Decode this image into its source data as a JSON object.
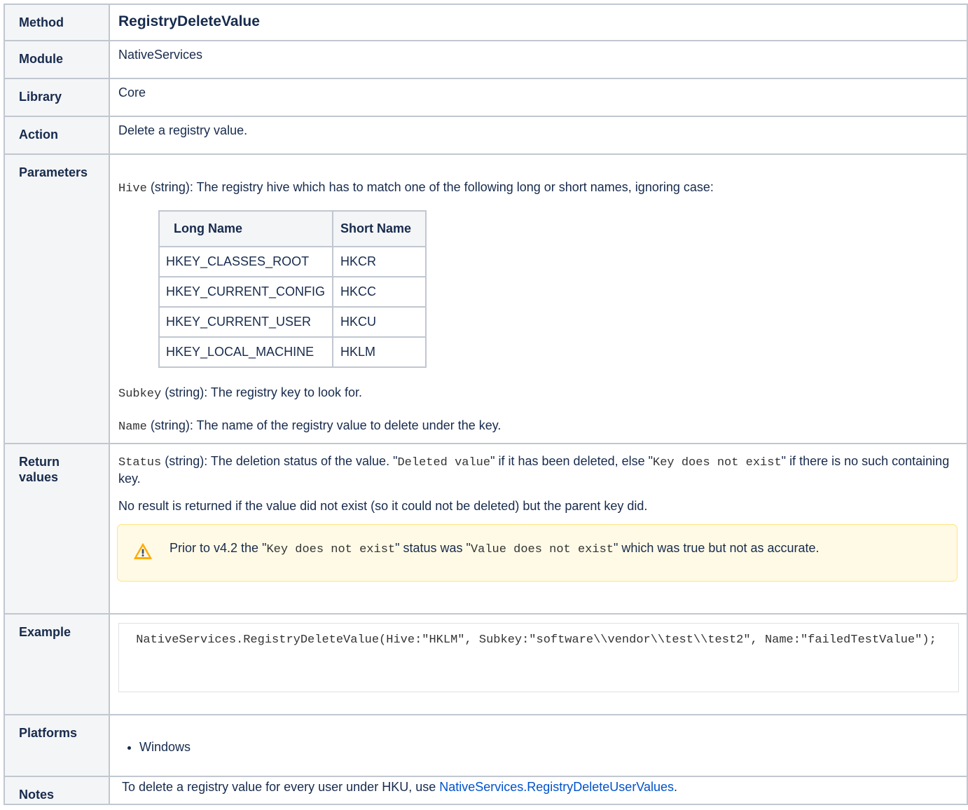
{
  "rows": {
    "method": {
      "label": "Method",
      "value": "RegistryDeleteValue"
    },
    "module": {
      "label": "Module",
      "value": "NativeServices"
    },
    "library": {
      "label": "Library",
      "value": "Core"
    },
    "action": {
      "label": "Action",
      "value": "Delete a registry value."
    },
    "parameters": {
      "label": "Parameters",
      "hive_code": "Hive",
      "hive_text": " (string): The registry hive which has to match one of the following long or short names, ignoring case:",
      "hive_table": {
        "headers": [
          "Long Name",
          "Short Name"
        ],
        "rows": [
          [
            "HKEY_CLASSES_ROOT",
            "HKCR"
          ],
          [
            "HKEY_CURRENT_CONFIG",
            "HKCC"
          ],
          [
            "HKEY_CURRENT_USER",
            "HKCU"
          ],
          [
            "HKEY_LOCAL_MACHINE",
            "HKLM"
          ]
        ]
      },
      "subkey_code": "Subkey",
      "subkey_text": " (string): The registry key to look for.",
      "name_code": "Name",
      "name_text": " (string): The name of the registry value to delete under the key."
    },
    "return_values": {
      "label_line1": "Return",
      "label_line2": "values",
      "status_code": "Status",
      "status_text1": " (string): The deletion status of the value. \"",
      "deleted_code": "Deleted value",
      "status_text2": "\" if it has been deleted, else \"",
      "keynot_code": "Key does not exist",
      "status_text3": "\" if there is no such containing key.",
      "no_result": "No result is returned if the value did not exist (so it could not be deleted) but the parent key did.",
      "warning": {
        "icon": "warning-icon",
        "text1": "Prior to v4.2 the \"",
        "code1": "Key does not exist",
        "text2": "\" status was \"",
        "code2": "Value does not exist",
        "text3": "\" which was true but not as accurate."
      }
    },
    "example": {
      "label": "Example",
      "code": " NativeServices.RegistryDeleteValue(Hive:\"HKLM\", Subkey:\"software\\\\vendor\\\\test\\\\test2\", Name:\"failedTestValue\");"
    },
    "platforms": {
      "label": "Platforms",
      "items": [
        "Windows"
      ]
    },
    "notes": {
      "label": "Notes",
      "text": "To delete a registry value for every user under HKU, use ",
      "link": "NativeServices.RegistryDeleteUserValues",
      "after": "."
    }
  },
  "colors": {
    "link": "#0052cc",
    "header_bg": "#f4f5f7",
    "border": "#c1c7d0",
    "warning_bg": "#fffae6",
    "warning_border": "#ffe380"
  }
}
